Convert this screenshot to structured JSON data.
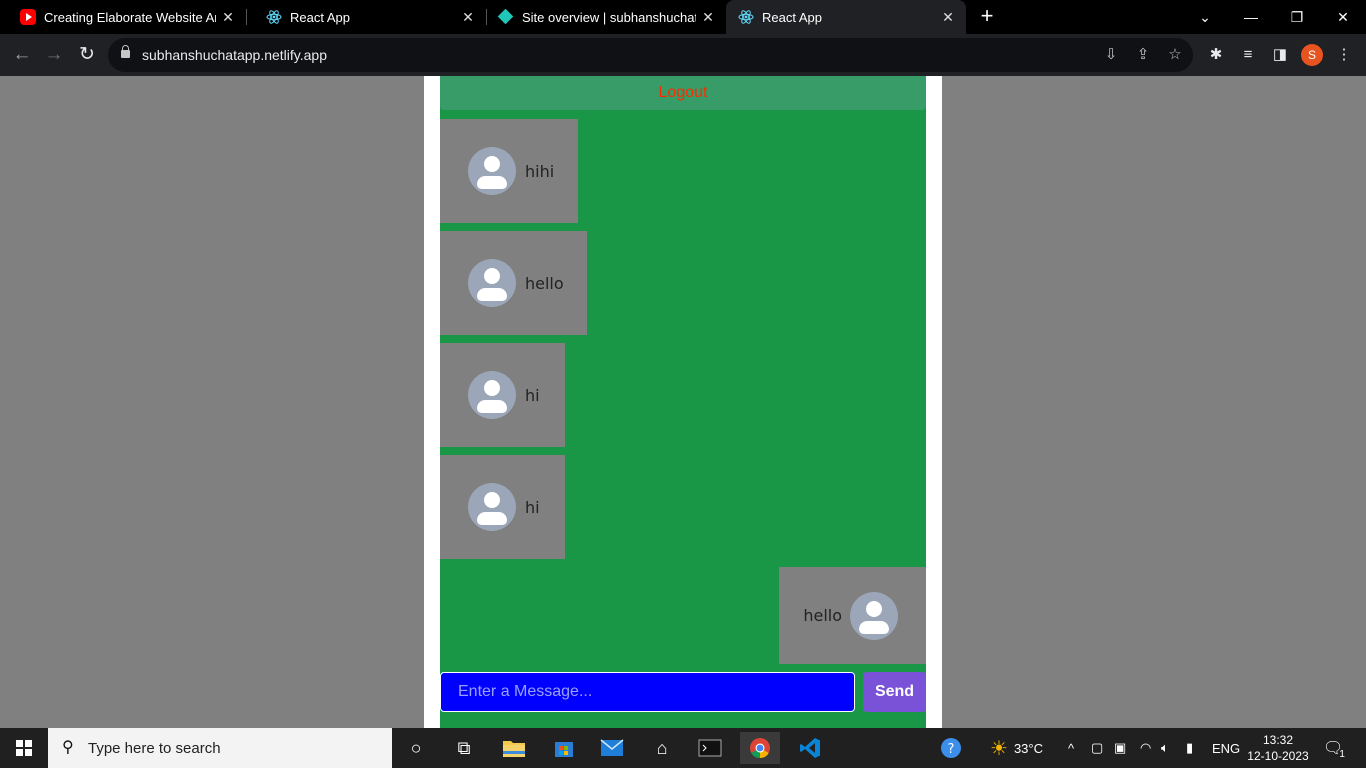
{
  "browser": {
    "tabs": [
      {
        "title": "Creating Elaborate Website Anim",
        "icon": "youtube-icon"
      },
      {
        "title": "React App",
        "icon": "react-icon"
      },
      {
        "title": "Site overview | subhanshuchatap",
        "icon": "netlify-icon"
      },
      {
        "title": "React App",
        "icon": "react-icon"
      }
    ],
    "active_tab": 3,
    "url": "subhanshuchatapp.netlify.app",
    "profile_initial": "S"
  },
  "chat": {
    "logout_label": "Logout",
    "messages": [
      {
        "text": "hihi",
        "side": "left"
      },
      {
        "text": "hello",
        "side": "left"
      },
      {
        "text": "hi",
        "side": "left"
      },
      {
        "text": "hi",
        "side": "left"
      },
      {
        "text": "hello",
        "side": "right"
      }
    ],
    "input_placeholder": "Enter a Message...",
    "send_label": "Send",
    "colors": {
      "panel": "#1a9647",
      "input": "#0000ff",
      "send": "#7a52d8",
      "logout_text": "#ff2a00"
    }
  },
  "taskbar": {
    "search_placeholder": "Type here to search",
    "temperature": "33°C",
    "language": "ENG",
    "time": "13:32",
    "date": "12-10-2023",
    "notification_count": "1"
  }
}
